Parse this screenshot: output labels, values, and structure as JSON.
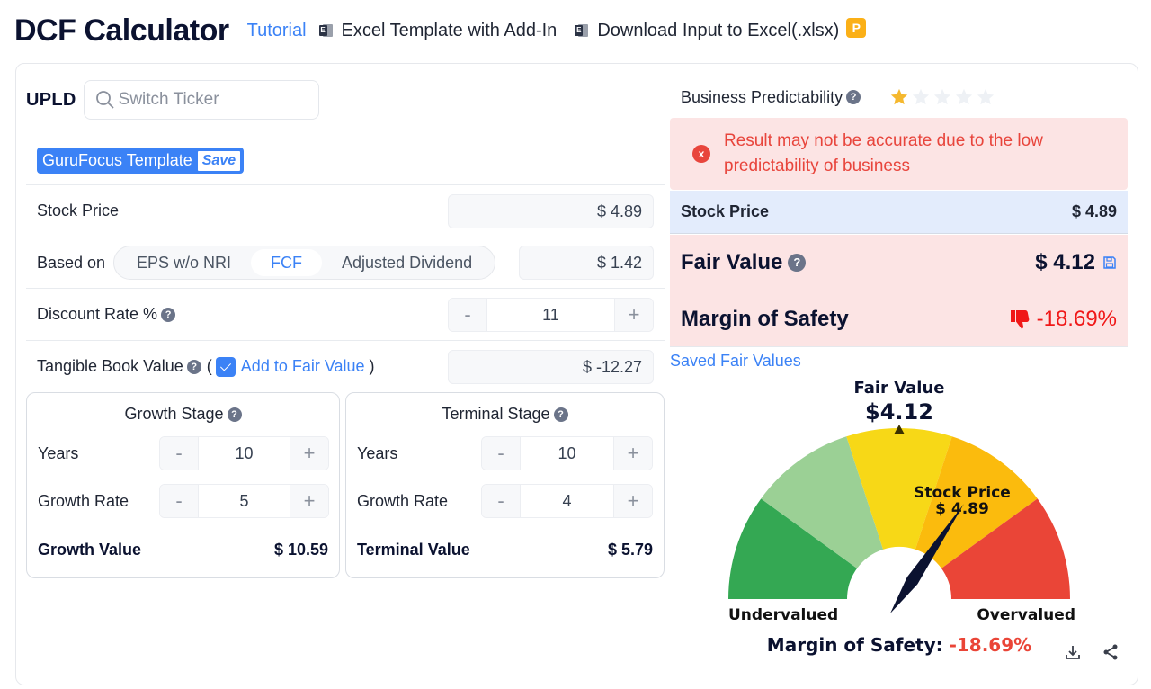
{
  "header": {
    "title": "DCF Calculator",
    "links": {
      "tutorial": "Tutorial",
      "excel_template": "Excel Template with Add-In",
      "download_input": "Download Input to Excel(.xlsx)"
    },
    "premium_badge": "P",
    "excel_icon_letter": "E"
  },
  "ticker": {
    "symbol": "UPLD",
    "search_placeholder": "Switch Ticker"
  },
  "template": {
    "label": "GuruFocus Template",
    "save_label": "Save"
  },
  "inputs": {
    "stock_price": {
      "label": "Stock Price",
      "value": "$ 4.89"
    },
    "based_on": {
      "label": "Based on",
      "options": [
        "EPS w/o NRI",
        "FCF",
        "Adjusted Dividend"
      ],
      "selected": "FCF",
      "value": "$ 1.42"
    },
    "discount_rate": {
      "label": "Discount Rate %",
      "value": "11",
      "minus": "-",
      "plus": "+"
    },
    "tangible_book": {
      "label": "Tangible Book Value",
      "open_paren": "(",
      "close_paren": ")",
      "checkbox_label": "Add to Fair Value",
      "checked": true,
      "value": "$ -12.27"
    }
  },
  "growth_stage": {
    "title": "Growth Stage",
    "years_label": "Years",
    "years": "10",
    "rate_label": "Growth Rate",
    "rate": "5",
    "total_label": "Growth Value",
    "total": "$ 10.59"
  },
  "terminal_stage": {
    "title": "Terminal Stage",
    "years_label": "Years",
    "years": "10",
    "rate_label": "Growth Rate",
    "rate": "4",
    "total_label": "Terminal Value",
    "total": "$ 5.79"
  },
  "results": {
    "predictability_label": "Business Predictability",
    "predictability_stars": 1,
    "predictability_max": 5,
    "alert": "Result may not be accurate due to the low predictability of business",
    "stock_price_label": "Stock Price",
    "stock_price": "$ 4.89",
    "fair_value_label": "Fair Value",
    "fair_value": "$ 4.12",
    "mos_label": "Margin of Safety",
    "mos": "-18.69%",
    "saved_link": "Saved Fair Values"
  },
  "gauge": {
    "fair_value_title": "Fair Value",
    "fair_value": "$4.12",
    "stock_price_title": "Stock Price",
    "stock_price": "$ 4.89",
    "left_label": "Undervalued",
    "right_label": "Overvalued",
    "mos_label": "Margin of Safety:",
    "mos_value": "-18.69%",
    "needle_fraction": 0.69,
    "marker_fraction": 0.5,
    "segment_colors": [
      "#34a853",
      "#9bd095",
      "#f7d817",
      "#fbbb0d",
      "#ea4537"
    ]
  },
  "colors": {
    "accent": "#3b82f6",
    "negative": "#f01818",
    "alert_bg": "#fce4e4",
    "star": "#f5b82e"
  }
}
